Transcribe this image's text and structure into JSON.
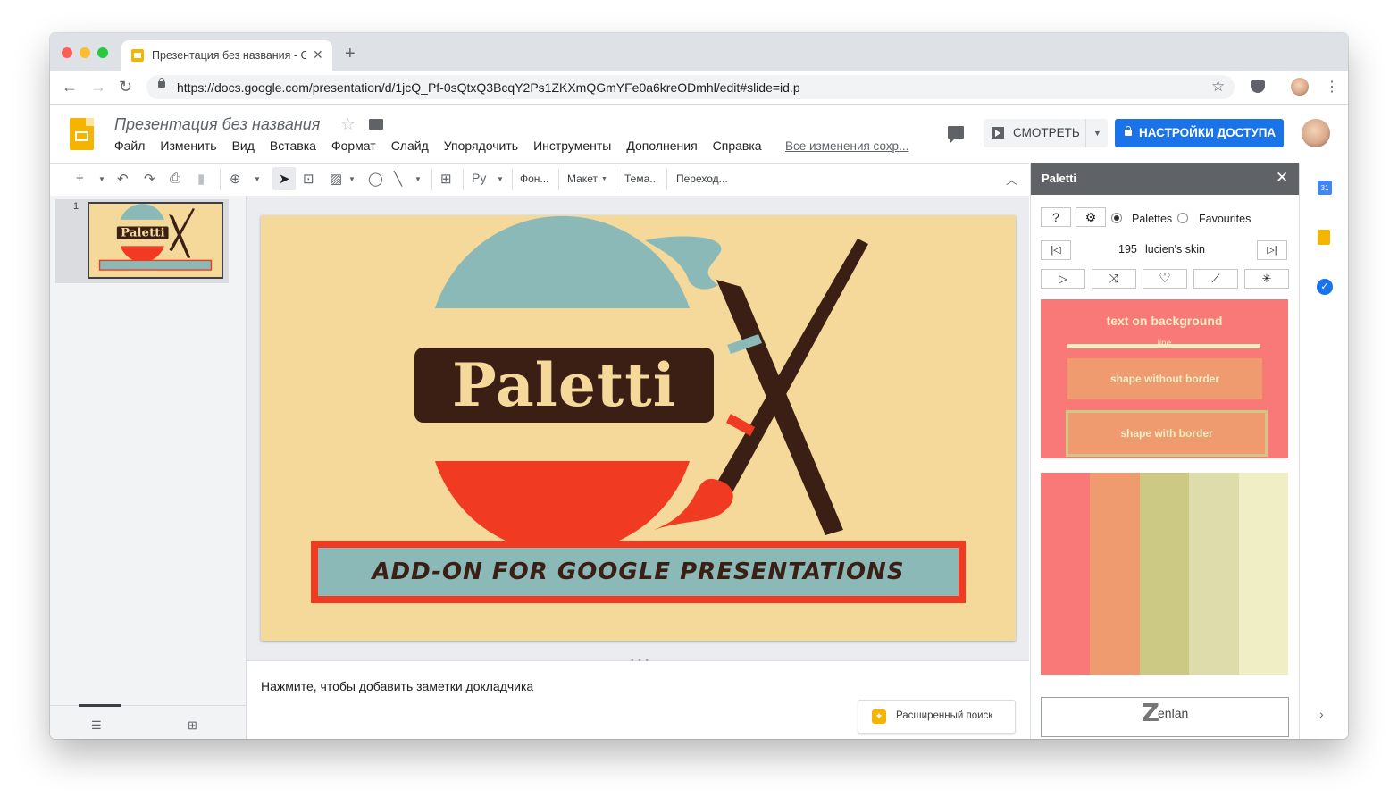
{
  "browser": {
    "tab_title": "Презентация без названия - Google Slides",
    "new_tab": "+",
    "url": "https://docs.google.com/presentation/d/1jcQ_Pf-0sQtxQ3BcqY2Ps1ZKXmQGmYFe0a6kreODmhl/edit#slide=id.p"
  },
  "doc": {
    "title": "Презентация без названия",
    "menu": [
      "Файл",
      "Изменить",
      "Вид",
      "Вставка",
      "Формат",
      "Слайд",
      "Упорядочить",
      "Инструменты",
      "Дополнения",
      "Справка"
    ],
    "saved_status": "Все изменения сохр...",
    "present_label": "СМОТРЕТЬ",
    "share_label": "НАСТРОЙКИ ДОСТУПА"
  },
  "toolbar": {
    "input_tool": "Ру",
    "background": "Фон...",
    "layout": "Макет",
    "theme": "Тема...",
    "transition": "Переход..."
  },
  "filmstrip": {
    "slide_number": "1"
  },
  "slide": {
    "logo_text": "Paletti",
    "banner_text": "ADD-ON FOR GOOGLE PRESENTATIONS"
  },
  "notes": {
    "placeholder": "Нажмите, чтобы добавить заметки докладчика",
    "explore_label": "Расширенный поиск"
  },
  "paletti": {
    "title": "Paletti",
    "help": "?",
    "mode_palettes": "Palettes",
    "mode_favourites": "Favourites",
    "mode_selected": "Palettes",
    "palette_number": "195",
    "palette_name": "lucien's skin",
    "preview": {
      "title": "text on background",
      "line_label": "line",
      "shape_no_border": "shape without border",
      "shape_border": "shape with border"
    },
    "swatches": [
      "#f97878",
      "#f09a6f",
      "#cbc983",
      "#dedcaa",
      "#f0eec4"
    ],
    "brand_z": "Z",
    "brand_rest": "enlan"
  },
  "colors": {
    "slide_bg": "#f4d99a",
    "logo_dark": "#3b1f14",
    "logo_teal": "#8ab9b8",
    "logo_red": "#f03a22",
    "share_blue": "#1a73e8",
    "panel_header": "#5f6368"
  },
  "icons": {
    "toolbar": [
      "plus-icon",
      "undo-icon",
      "redo-icon",
      "print-icon",
      "paint-format-icon",
      "zoom-icon",
      "cursor-icon",
      "textbox-icon",
      "image-icon",
      "shape-icon",
      "line-icon",
      "comment-add-icon"
    ],
    "paletti_buttons": [
      "first-icon",
      "last-icon",
      "play-icon",
      "shuffle-icon",
      "heart-icon",
      "wand-icon",
      "magic-wand-icon"
    ],
    "side_apps": [
      "calendar-icon",
      "keep-icon",
      "tasks-icon"
    ]
  }
}
